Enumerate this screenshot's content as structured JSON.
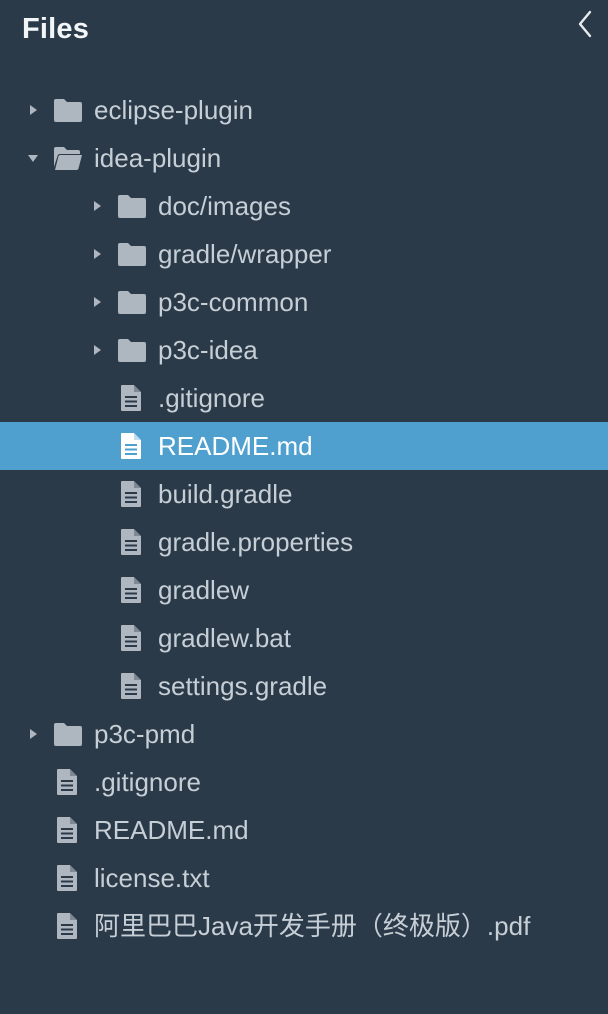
{
  "panel": {
    "title": "Files",
    "collapse_icon": "chevron-left-icon"
  },
  "tree": {
    "items": [
      {
        "label": "eclipse-plugin",
        "type": "folder",
        "state": "collapsed",
        "depth": 0,
        "icon": "folder-icon"
      },
      {
        "label": "idea-plugin",
        "type": "folder",
        "state": "expanded",
        "depth": 0,
        "icon": "folder-open-icon"
      },
      {
        "label": "doc/images",
        "type": "folder",
        "state": "collapsed",
        "depth": 1,
        "icon": "folder-icon"
      },
      {
        "label": "gradle/wrapper",
        "type": "folder",
        "state": "collapsed",
        "depth": 1,
        "icon": "folder-icon"
      },
      {
        "label": "p3c-common",
        "type": "folder",
        "state": "collapsed",
        "depth": 1,
        "icon": "folder-icon"
      },
      {
        "label": "p3c-idea",
        "type": "folder",
        "state": "collapsed",
        "depth": 1,
        "icon": "folder-icon"
      },
      {
        "label": ".gitignore",
        "type": "file",
        "depth": 1,
        "icon": "file-icon"
      },
      {
        "label": "README.md",
        "type": "file",
        "depth": 1,
        "icon": "file-icon",
        "selected": true
      },
      {
        "label": "build.gradle",
        "type": "file",
        "depth": 1,
        "icon": "file-icon"
      },
      {
        "label": "gradle.properties",
        "type": "file",
        "depth": 1,
        "icon": "file-icon"
      },
      {
        "label": "gradlew",
        "type": "file",
        "depth": 1,
        "icon": "file-icon"
      },
      {
        "label": "gradlew.bat",
        "type": "file",
        "depth": 1,
        "icon": "file-icon"
      },
      {
        "label": "settings.gradle",
        "type": "file",
        "depth": 1,
        "icon": "file-icon"
      },
      {
        "label": "p3c-pmd",
        "type": "folder",
        "state": "collapsed",
        "depth": 0,
        "icon": "folder-icon"
      },
      {
        "label": ".gitignore",
        "type": "file",
        "depth": 0,
        "icon": "file-icon"
      },
      {
        "label": "README.md",
        "type": "file",
        "depth": 0,
        "icon": "file-icon"
      },
      {
        "label": "license.txt",
        "type": "file",
        "depth": 0,
        "icon": "file-icon"
      },
      {
        "label": "阿里巴巴Java开发手册（终极版）.pdf",
        "type": "file",
        "depth": 0,
        "icon": "file-icon"
      }
    ]
  },
  "colors": {
    "background": "#2b3a48",
    "selection": "#4fa0cf",
    "text": "#c6ced6",
    "icon": "#aeb6bf",
    "title": "#f3f6f9"
  }
}
